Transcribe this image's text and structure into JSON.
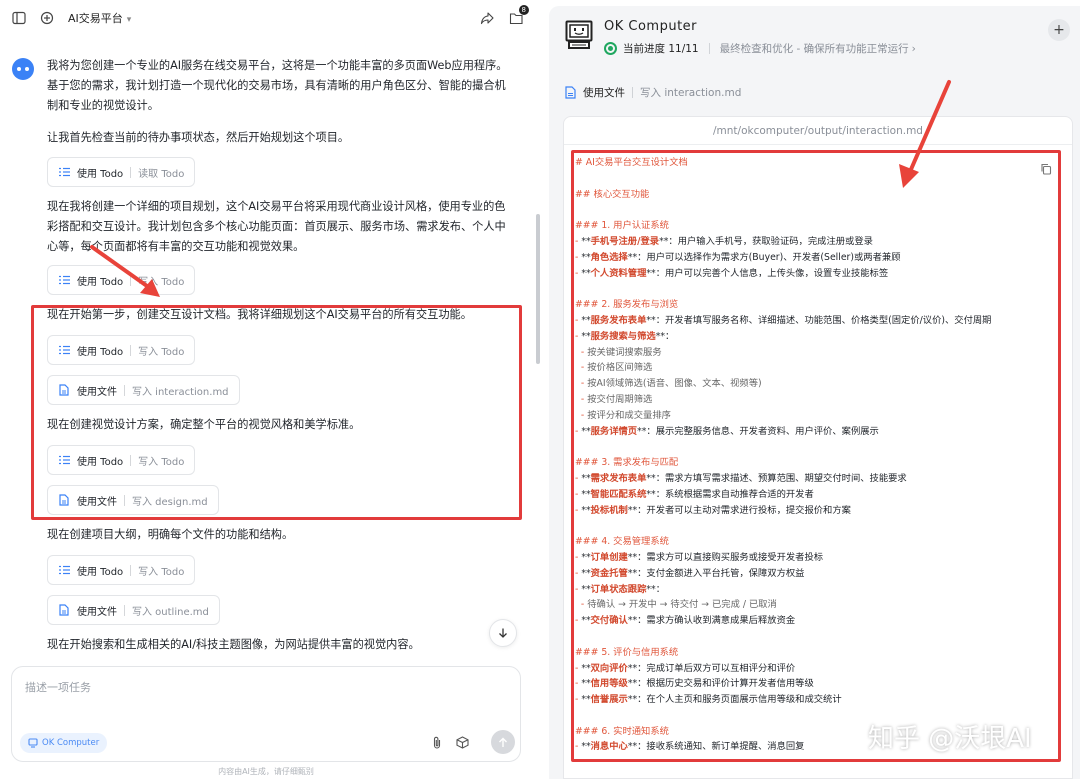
{
  "header": {
    "title": "AI交易平台",
    "notification_count": "8"
  },
  "messages": [
    {
      "text": "我将为您创建一个专业的AI服务在线交易平台，这将是一个功能丰富的多页面Web应用程序。基于您的需求，我计划打造一个现代化的交易市场，具有清晰的用户角色区分、智能的撮合机制和专业的视觉设计。"
    },
    {
      "text": "让我首先检查当前的待办事项状态，然后开始规划这个项目。"
    },
    {
      "text": "现在我将创建一个详细的项目规划，这个AI交易平台将采用现代商业设计风格，使用专业的色彩搭配和交互设计。我计划包含多个核心功能页面：首页展示、服务市场、需求发布、个人中心等，每个页面都将有丰富的交互功能和视觉效果。"
    },
    {
      "text": "现在开始第一步，创建交互设计文档。我将详细规划这个AI交易平台的所有交互功能。"
    },
    {
      "text": "现在创建视觉设计方案，确定整个平台的视觉风格和美学标准。"
    },
    {
      "text": "现在创建项目大纲，明确每个文件的功能和结构。"
    },
    {
      "text": "现在开始搜索和生成相关的AI/科技主题图像，为网站提供丰富的视觉内容。"
    }
  ],
  "chips": [
    {
      "label": "使用 Todo",
      "action": "读取 Todo"
    },
    {
      "label": "使用 Todo",
      "action": "写入 Todo"
    },
    {
      "label": "使用 Todo",
      "action": "写入 Todo"
    },
    {
      "label": "使用文件",
      "action": "写入 interaction.md"
    },
    {
      "label": "使用 Todo",
      "action": "写入 Todo"
    },
    {
      "label": "使用文件",
      "action": "写入 design.md"
    },
    {
      "label": "使用 Todo",
      "action": "写入 Todo"
    },
    {
      "label": "使用文件",
      "action": "写入 outline.md"
    }
  ],
  "composer": {
    "placeholder": "描述一项任务",
    "mode_label": "OK Computer",
    "footnote": "内容由AI生成，请仔细甄别"
  },
  "right_panel": {
    "title": "OK Computer",
    "progress_label": "当前进度 11/11",
    "progress_desc": "最终检查和优化 - 确保所有功能正常运行",
    "file_use_label": "使用文件",
    "file_use_action": "写入 interaction.md",
    "path": "/mnt/okcomputer/output/interaction.md"
  },
  "doc": {
    "title": "# AI交易平台交互设计文档",
    "section": "## 核心交互功能",
    "groups": [
      {
        "heading": "### 1. 用户认证系统",
        "items": [
          {
            "bold": "手机号注册/登录",
            "rest": "：用户输入手机号，获取验证码，完成注册或登录"
          },
          {
            "bold": "角色选择",
            "rest": "：用户可以选择作为需求方(Buyer)、开发者(Seller)或两者兼顾"
          },
          {
            "bold": "个人资料管理",
            "rest": "：用户可以完善个人信息，上传头像，设置专业技能标签"
          }
        ]
      },
      {
        "heading": "### 2. 服务发布与浏览",
        "items": [
          {
            "bold": "服务发布表单",
            "rest": "：开发者填写服务名称、详细描述、功能范围、价格类型(固定价/议价)、交付周期"
          },
          {
            "bold": "服务搜索与筛选",
            "rest": "：",
            "subs": [
              "按关键词搜索服务",
              "按价格区间筛选",
              "按AI领域筛选(语音、图像、文本、视频等)",
              "按交付周期筛选",
              "按评分和成交量排序"
            ]
          },
          {
            "bold": "服务详情页",
            "rest": "：展示完整服务信息、开发者资料、用户评价、案例展示"
          }
        ]
      },
      {
        "heading": "### 3. 需求发布与匹配",
        "items": [
          {
            "bold": "需求发布表单",
            "rest": "：需求方填写需求描述、预算范围、期望交付时间、技能要求"
          },
          {
            "bold": "智能匹配系统",
            "rest": "：系统根据需求自动推荐合适的开发者"
          },
          {
            "bold": "投标机制",
            "rest": "：开发者可以主动对需求进行投标，提交报价和方案"
          }
        ]
      },
      {
        "heading": "### 4. 交易管理系统",
        "items": [
          {
            "bold": "订单创建",
            "rest": "：需求方可以直接购买服务或接受开发者投标"
          },
          {
            "bold": "资金托管",
            "rest": "：支付金额进入平台托管，保障双方权益"
          },
          {
            "bold": "订单状态跟踪",
            "rest": "：",
            "subs": [
              "待确认 → 开发中 → 待交付 → 已完成 / 已取消"
            ]
          },
          {
            "bold": "交付确认",
            "rest": "：需求方确认收到满意成果后释放资金"
          }
        ]
      },
      {
        "heading": "### 5. 评价与信用系统",
        "items": [
          {
            "bold": "双向评价",
            "rest": "：完成订单后双方可以互相评分和评价"
          },
          {
            "bold": "信用等级",
            "rest": "：根据历史交易和评价计算开发者信用等级"
          },
          {
            "bold": "信誉展示",
            "rest": "：在个人主页和服务页面展示信用等级和成交统计"
          }
        ]
      },
      {
        "heading": "### 6. 实时通知系统",
        "items": [
          {
            "bold": "消息中心",
            "rest": "：接收系统通知、新订单提醒、消息回复"
          }
        ]
      }
    ]
  },
  "watermark": "知乎 @沃垠AI"
}
